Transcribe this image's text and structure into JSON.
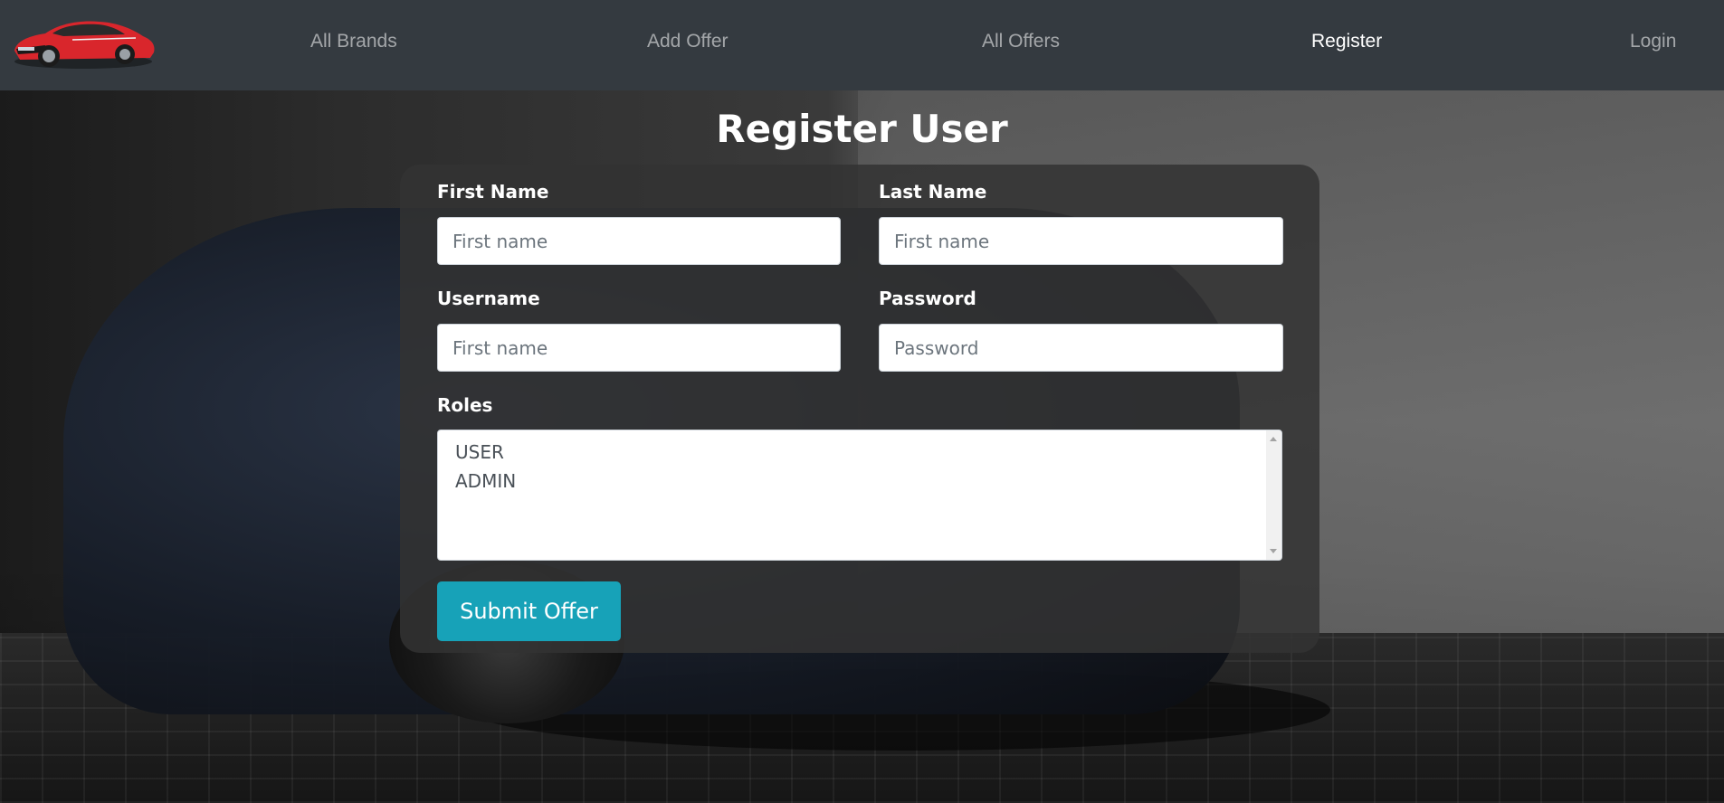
{
  "navbar": {
    "logo_icon": "red-sports-car-logo",
    "links": {
      "all_brands": "All Brands",
      "add_offer": "Add Offer",
      "all_offers": "All Offers",
      "register": "Register",
      "login": "Login"
    },
    "active": "Register",
    "background_color": "#343a40"
  },
  "page": {
    "title": "Register User"
  },
  "form": {
    "first_name": {
      "label": "First Name",
      "value": "",
      "placeholder": "First name"
    },
    "last_name": {
      "label": "Last Name",
      "value": "",
      "placeholder": "First name"
    },
    "username": {
      "label": "Username",
      "value": "",
      "placeholder": "First name"
    },
    "password": {
      "label": "Password",
      "value": "",
      "placeholder": "Password"
    },
    "roles": {
      "label": "Roles",
      "options": [
        "USER",
        "ADMIN"
      ]
    },
    "submit_label": "Submit Offer",
    "accent_color": "#17a2b8"
  }
}
